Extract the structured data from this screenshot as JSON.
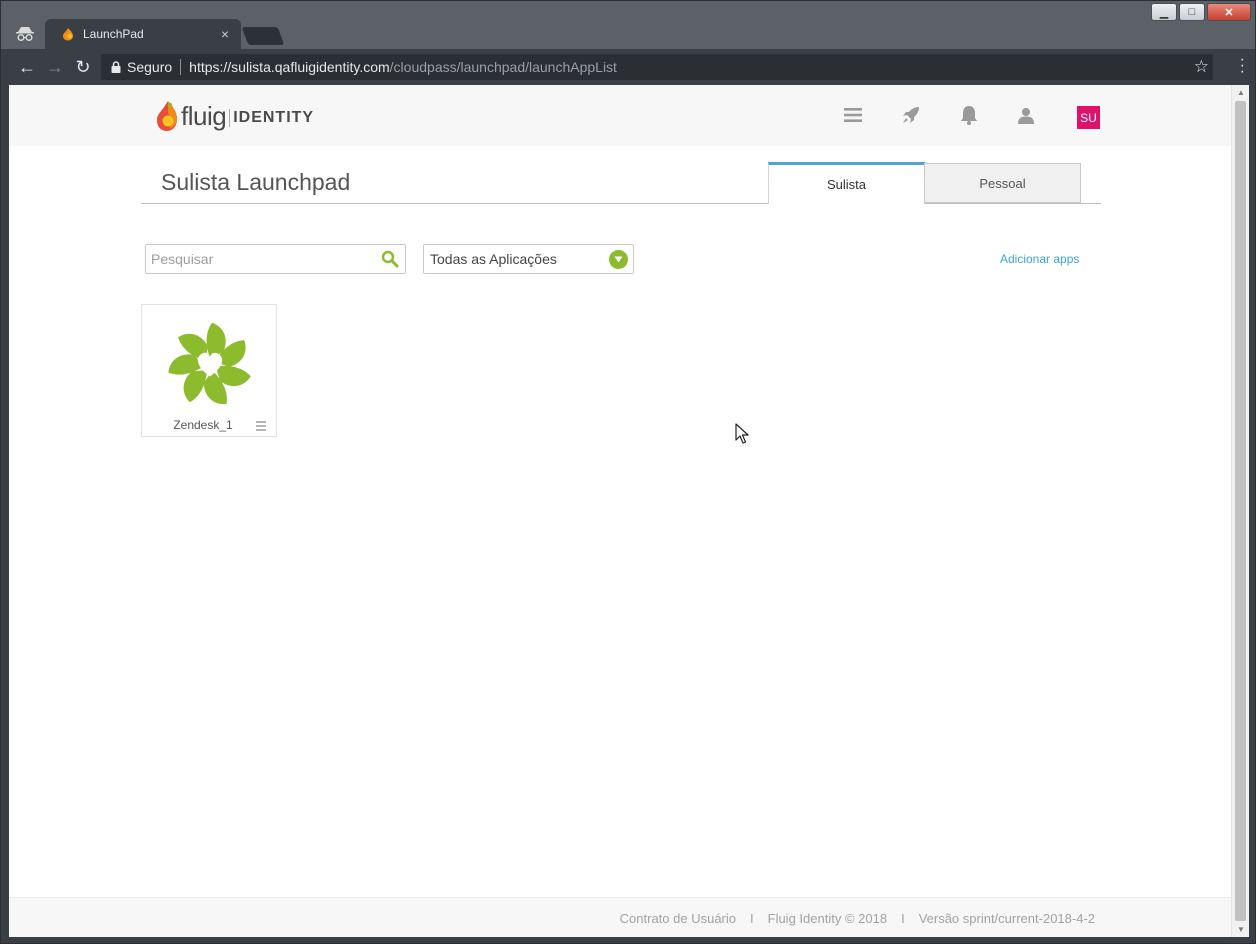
{
  "browser": {
    "tab_title": "LaunchPad",
    "tab_close": "×",
    "security_label": "Seguro",
    "url_host": "https://sulista.qafluigidentity.com",
    "url_path": "/cloudpass/launchpad/launchAppList"
  },
  "header": {
    "logo_text": "fluig",
    "logo_product": "IDENTITY",
    "avatar_initials": "SU",
    "avatar_color": "#e0116b"
  },
  "main": {
    "title": "Sulista Launchpad",
    "tabs": [
      {
        "label": "Sulista",
        "active": true
      },
      {
        "label": "Pessoal",
        "active": false
      }
    ],
    "search": {
      "placeholder": "Pesquisar",
      "value": ""
    },
    "filter": {
      "selected": "Todas as Aplicações"
    },
    "add_apps_label": "Adicionar apps",
    "apps": [
      {
        "name": "Zendesk_1",
        "icon": "zendesk-flower-logo",
        "color": "#8dbb2e"
      }
    ]
  },
  "footer": {
    "links": [
      "Contrato de Usuário",
      "Fluig Identity © 2018",
      "Versão sprint/current-2018-4-2"
    ],
    "separator": "I"
  },
  "colors": {
    "accent_blue": "#4da6d6",
    "accent_green": "#8dbb2e",
    "link_blue": "#3fa3d6"
  }
}
